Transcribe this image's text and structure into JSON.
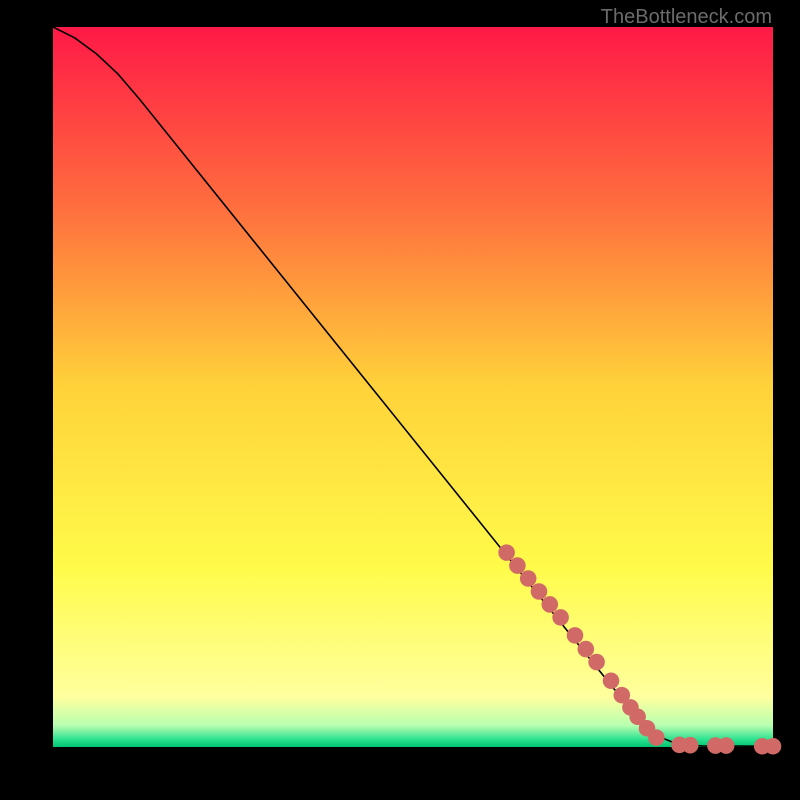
{
  "attribution": "TheBottleneck.com",
  "colors": {
    "line": "#000000",
    "marker": "#d16a66",
    "frame": "#000000"
  },
  "chart_data": {
    "type": "line",
    "title": "",
    "xlabel": "",
    "ylabel": "",
    "xlim": [
      0,
      100
    ],
    "ylim": [
      0,
      100
    ],
    "gradient": [
      {
        "stop": 0,
        "color": "#ff1947"
      },
      {
        "stop": 25,
        "color": "#ff6e3e"
      },
      {
        "stop": 50,
        "color": "#ffd23a"
      },
      {
        "stop": 75,
        "color": "#fffb4a"
      },
      {
        "stop": 93,
        "color": "#ffff9e"
      },
      {
        "stop": 97,
        "color": "#b9ffb0"
      },
      {
        "stop": 99,
        "color": "#28e18f"
      },
      {
        "stop": 100,
        "color": "#00c471"
      }
    ],
    "series": [
      {
        "name": "curve",
        "points": [
          {
            "x": 0,
            "y": 100
          },
          {
            "x": 3,
            "y": 98.5
          },
          {
            "x": 6,
            "y": 96.3
          },
          {
            "x": 9,
            "y": 93.5
          },
          {
            "x": 12,
            "y": 90
          },
          {
            "x": 82,
            "y": 3
          },
          {
            "x": 84,
            "y": 1.5
          },
          {
            "x": 86,
            "y": 0.7
          },
          {
            "x": 88,
            "y": 0.3
          },
          {
            "x": 90,
            "y": 0.15
          },
          {
            "x": 100,
            "y": 0.1
          }
        ]
      }
    ],
    "markers": [
      {
        "x": 63,
        "y": 27
      },
      {
        "x": 64.5,
        "y": 25.2
      },
      {
        "x": 66,
        "y": 23.4
      },
      {
        "x": 67.5,
        "y": 21.6
      },
      {
        "x": 69,
        "y": 19.8
      },
      {
        "x": 70.5,
        "y": 18
      },
      {
        "x": 72.5,
        "y": 15.5
      },
      {
        "x": 74,
        "y": 13.6
      },
      {
        "x": 75.5,
        "y": 11.8
      },
      {
        "x": 77.5,
        "y": 9.2
      },
      {
        "x": 79,
        "y": 7.2
      },
      {
        "x": 80.2,
        "y": 5.5
      },
      {
        "x": 81.2,
        "y": 4.2
      },
      {
        "x": 82.5,
        "y": 2.6
      },
      {
        "x": 83.8,
        "y": 1.3
      },
      {
        "x": 87,
        "y": 0.3
      },
      {
        "x": 88.5,
        "y": 0.25
      },
      {
        "x": 92,
        "y": 0.2
      },
      {
        "x": 93.5,
        "y": 0.2
      },
      {
        "x": 98.5,
        "y": 0.1
      },
      {
        "x": 100,
        "y": 0.1
      }
    ],
    "marker_radius": 1.15
  }
}
